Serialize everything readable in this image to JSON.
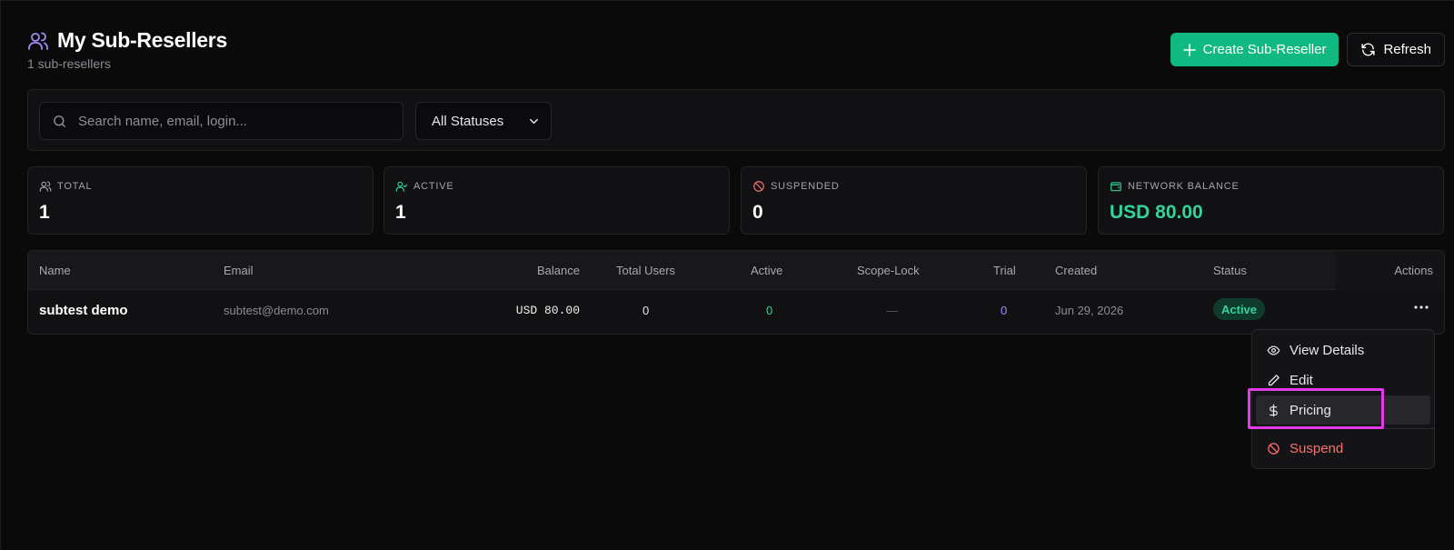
{
  "header": {
    "title": "My Sub-Resellers",
    "subtitle": "1 sub-resellers",
    "create_label": "Create Sub-Reseller",
    "refresh_label": "Refresh"
  },
  "filters": {
    "search_placeholder": "Search name, email, login...",
    "status_selected": "All Statuses"
  },
  "stats": [
    {
      "label": "TOTAL",
      "value": "1",
      "icon": "users-icon"
    },
    {
      "label": "ACTIVE",
      "value": "1",
      "icon": "user-check-icon"
    },
    {
      "label": "SUSPENDED",
      "value": "0",
      "icon": "ban-icon"
    },
    {
      "label": "NETWORK BALANCE",
      "value": "USD 80.00",
      "icon": "wallet-icon"
    }
  ],
  "table": {
    "columns": [
      "Name",
      "Email",
      "Balance",
      "Total Users",
      "Active",
      "Scope-Lock",
      "Trial",
      "Created",
      "Status",
      "Actions"
    ],
    "rows": [
      {
        "name": "subtest demo",
        "email": "subtest@demo.com",
        "balance": "USD 80.00",
        "total_users": "0",
        "active": "0",
        "scope_lock": "—",
        "trial": "0",
        "created": "Jun 29, 2026",
        "status": "Active"
      }
    ]
  },
  "menu": {
    "items": [
      {
        "label": "View Details",
        "icon": "eye-icon"
      },
      {
        "label": "Edit",
        "icon": "pencil-icon"
      },
      {
        "label": "Pricing",
        "icon": "dollar-icon"
      },
      {
        "label": "Suspend",
        "icon": "ban-icon"
      }
    ]
  },
  "colors": {
    "accent": "#10b981",
    "title_icon": "#a78bfa",
    "danger": "#f87171",
    "highlight": "#e23ae6"
  }
}
